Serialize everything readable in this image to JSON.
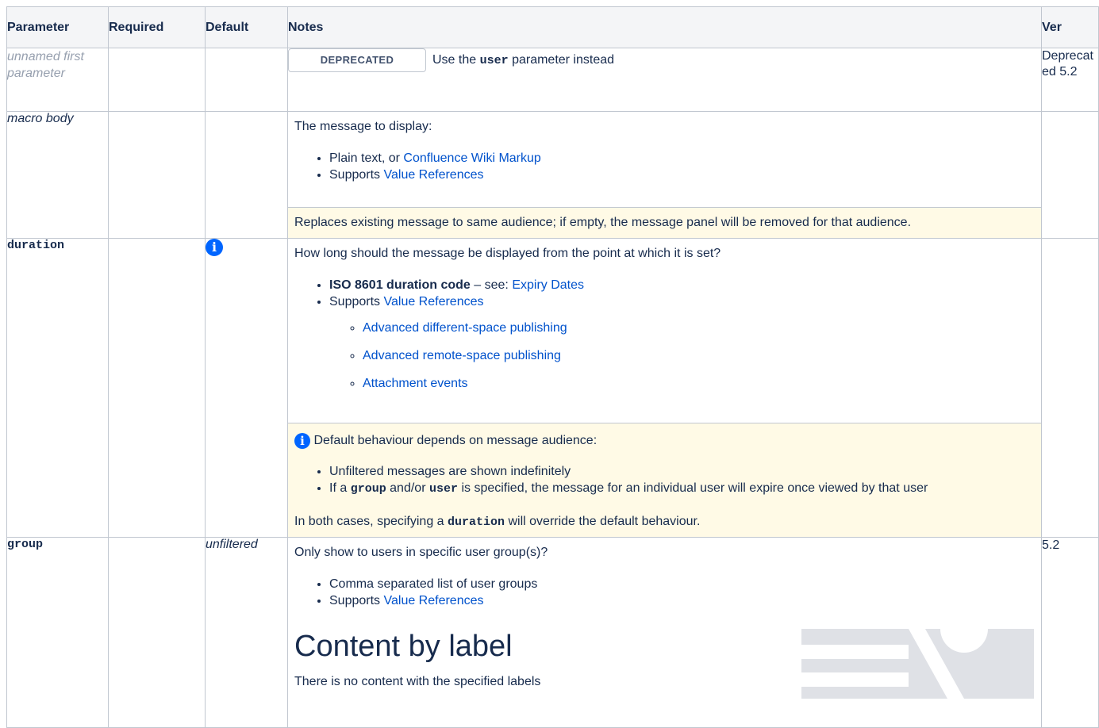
{
  "headers": {
    "parameter": "Parameter",
    "required": "Required",
    "default": "Default",
    "notes": "Notes",
    "ver": "Ver"
  },
  "rows": {
    "unnamed": {
      "param": "unnamed first parameter",
      "badge": "DEPRECATED",
      "note_pre": "Use the",
      "note_code": "user",
      "note_post": "parameter instead",
      "ver": "Deprecated 5.2"
    },
    "macro_body": {
      "param": "macro body",
      "intro": "The message to display:",
      "item1_text": "Plain text, or",
      "item1_link": "Confluence Wiki Markup",
      "item2_text": "Supports",
      "item2_link": "Value References",
      "panel": "Replaces existing message to same audience; if empty, the message panel will be removed for that audience."
    },
    "duration": {
      "param": "duration",
      "default_icon": "info-icon",
      "intro": "How long should the message be displayed from the point at which it is set?",
      "item1_bold": "ISO 8601 duration code",
      "item1_text": "– see:",
      "item1_link": "Expiry Dates",
      "item2_text": "Supports",
      "item2_link": "Value References",
      "sublinks": [
        "Advanced different-space publishing",
        "Advanced remote-space publishing",
        "Attachment events"
      ],
      "panel_heading": "Default behaviour depends on message audience:",
      "panel_item1": "Unfiltered messages are shown indefinitely",
      "panel_item2_pre": "If a",
      "panel_item2_code1": "group",
      "panel_item2_mid": "and/or",
      "panel_item2_code2": "user",
      "panel_item2_post": "is specified, the message for an individual user will expire once viewed by that user",
      "panel_footer_pre": "In both cases, specifying a",
      "panel_footer_code": "duration",
      "panel_footer_post": "will override the default behaviour."
    },
    "group": {
      "param": "group",
      "default": "unfiltered",
      "intro": "Only show to users in specific user group(s)?",
      "item1_text": "Comma separated list of user groups",
      "item2_text": "Supports",
      "item2_link": "Value References",
      "cbl_title": "Content by label",
      "cbl_text": "There is no content with the specified labels",
      "ver": "5.2"
    }
  },
  "colors": {
    "link": "#0052cc",
    "panel_bg": "#fffae6",
    "header_bg": "#f4f5f7",
    "info_icon": "#0065ff",
    "border": "#c1c7d0"
  }
}
